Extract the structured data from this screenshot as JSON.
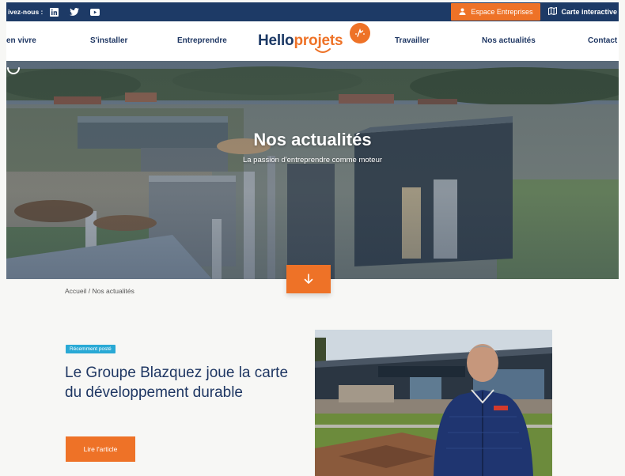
{
  "topbar": {
    "follow_label": "ivez-nous :",
    "social": [
      "linkedin-icon",
      "twitter-icon",
      "youtube-icon"
    ],
    "espace_label": "Espace Entreprises",
    "carte_label": "Carte interactive"
  },
  "nav": {
    "items": [
      "en vivre",
      "S'installer",
      "Entreprendre",
      "Travailler",
      "Nos actualités",
      "Contact"
    ],
    "logo_hello": "Hello",
    "logo_projets": "projets"
  },
  "hero": {
    "title": "Nos actualités",
    "subtitle": "La passion d'entreprendre comme moteur"
  },
  "breadcrumb": "Accueil / Nos actualités",
  "article": {
    "badge": "Récemment posté",
    "title": "Le Groupe Blazquez joue la carte du développement durable",
    "read_label": "Lire l'article"
  },
  "colors": {
    "navy": "#1d3a66",
    "orange": "#ee7227",
    "badge_blue": "#29a9d5"
  }
}
